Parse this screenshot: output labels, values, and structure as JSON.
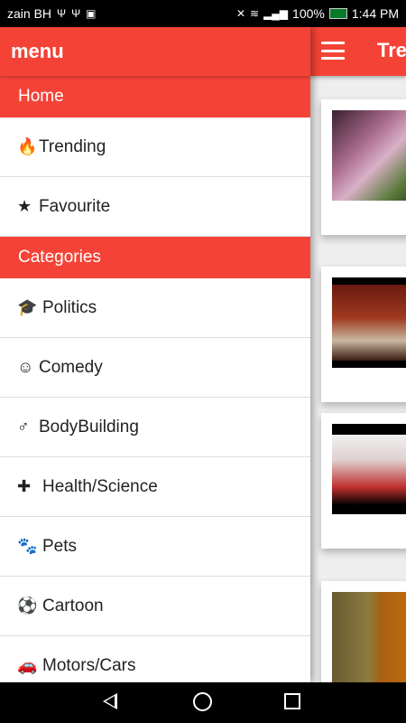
{
  "status_bar": {
    "carrier": "zain BH",
    "battery": "100%",
    "time": "1:44 PM"
  },
  "main": {
    "title": "Tre"
  },
  "drawer": {
    "title": "menu",
    "home_label": "Home",
    "items": [
      {
        "label": "Trending",
        "icon": "fire-icon",
        "glyph": "🔥"
      },
      {
        "label": "Favourite",
        "icon": "star-icon",
        "glyph": "★"
      }
    ],
    "categories_label": "Categories",
    "categories": [
      {
        "label": "Politics",
        "icon": "graduation-cap-icon",
        "glyph": "🎓"
      },
      {
        "label": "Comedy",
        "icon": "smile-icon",
        "glyph": "☺"
      },
      {
        "label": "BodyBuilding",
        "icon": "male-icon",
        "glyph": "♂"
      },
      {
        "label": "Health/Science",
        "icon": "medkit-icon",
        "glyph": "✚"
      },
      {
        "label": "Pets",
        "icon": "paw-icon",
        "glyph": "🐾"
      },
      {
        "label": "Cartoon",
        "icon": "soccer-ball-icon",
        "glyph": "⚽"
      },
      {
        "label": "Motors/Cars",
        "icon": "car-icon",
        "glyph": "🚗"
      }
    ]
  },
  "colors": {
    "accent": "#f44336"
  }
}
